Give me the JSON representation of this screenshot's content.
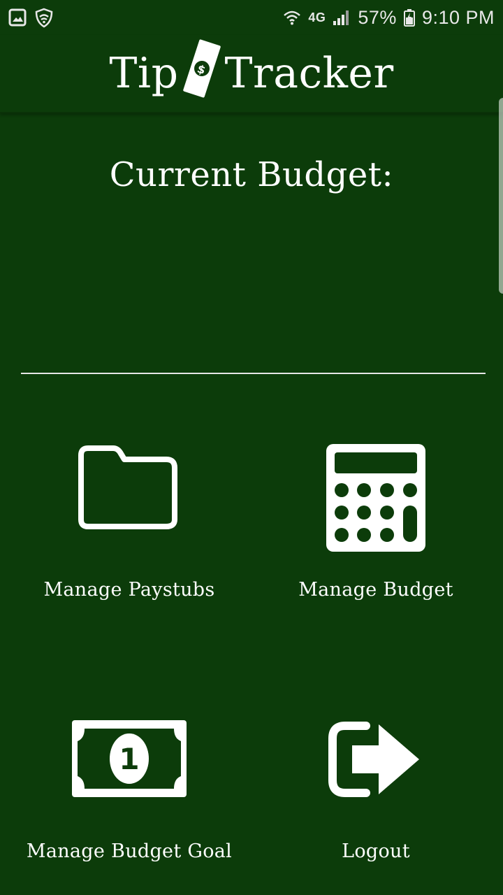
{
  "status_bar": {
    "battery": "57%",
    "time": "9:10 PM",
    "network": "4G",
    "icons": [
      "gallery-icon",
      "shield-icon",
      "wifi-icon",
      "signal-icon",
      "battery-icon"
    ]
  },
  "header": {
    "logo_left": "Tip",
    "logo_right": "Tracker",
    "logo_icon": "dollar-bill-icon"
  },
  "main": {
    "budget_title": "Current Budget:",
    "budget_value": ""
  },
  "menu": [
    {
      "label": "Manage Paystubs",
      "icon": "folder-icon"
    },
    {
      "label": "Manage Budget",
      "icon": "calculator-icon"
    },
    {
      "label": "Manage Budget Goal",
      "icon": "money-bill-icon"
    },
    {
      "label": "Logout",
      "icon": "logout-icon"
    }
  ],
  "colors": {
    "background": "#0c3c0a",
    "foreground": "#ffffff"
  }
}
